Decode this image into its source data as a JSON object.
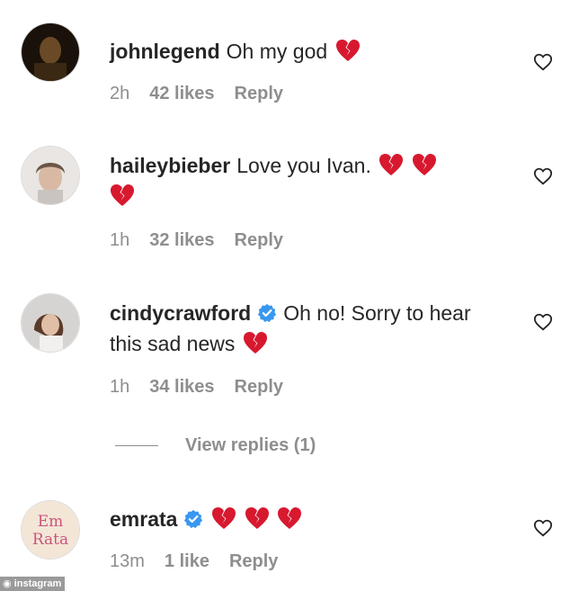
{
  "comments": [
    {
      "username": "johnlegend",
      "text": "Oh my god",
      "time": "2h",
      "likes": "42 likes",
      "reply": "Reply",
      "verified": false,
      "hearts": 1
    },
    {
      "username": "haileybieber",
      "text": "Love you Ivan.",
      "time": "1h",
      "likes": "32 likes",
      "reply": "Reply",
      "verified": false,
      "hearts": 3
    },
    {
      "username": "cindycrawford",
      "text": "Oh no! Sorry to hear this sad news",
      "time": "1h",
      "likes": "34 likes",
      "reply": "Reply",
      "verified": true,
      "hearts": 1
    },
    {
      "username": "emrata",
      "text": "",
      "time": "13m",
      "likes": "1 like",
      "reply": "Reply",
      "verified": true,
      "hearts": 3,
      "avatar_text": [
        "Em",
        "Rata"
      ]
    }
  ],
  "view_replies": "View replies (1)",
  "watermark": "instagram",
  "colors": {
    "heart": "#d7192f",
    "verified": "#3897f0",
    "meta": "#8e8e8e",
    "text": "#262626"
  },
  "icons": {
    "like": "heart-outline-icon",
    "broken_heart": "broken-heart-emoji",
    "verified": "verified-badge-icon"
  }
}
